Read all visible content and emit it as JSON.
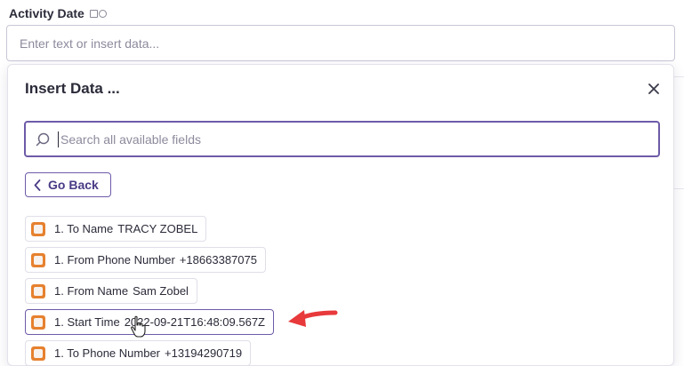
{
  "field": {
    "label": "Activity Date",
    "placeholder": "Enter text or insert data..."
  },
  "panel": {
    "title": "Insert Data ...",
    "search_placeholder": "Search all available fields",
    "back_label": "Go Back",
    "items": [
      {
        "label": "1. To Name",
        "value": "TRACY ZOBEL"
      },
      {
        "label": "1. From Phone Number",
        "value": "+18663387075"
      },
      {
        "label": "1. From Name",
        "value": "Sam Zobel"
      },
      {
        "label": "1. Start Time",
        "value": "2022-09-21T16:48:09.567Z"
      },
      {
        "label": "1. To Phone Number",
        "value": "+13194290719"
      }
    ]
  },
  "colors": {
    "accent": "#6e5ba8",
    "app_icon": "#e6812f",
    "arrow": "#e8393b"
  },
  "icons": {
    "close": "close-icon",
    "search": "search-icon",
    "back": "chevron-left-icon",
    "app": "app-logo-icon",
    "pointer": "hand-pointer-icon",
    "annotation": "red-arrow-icon"
  }
}
